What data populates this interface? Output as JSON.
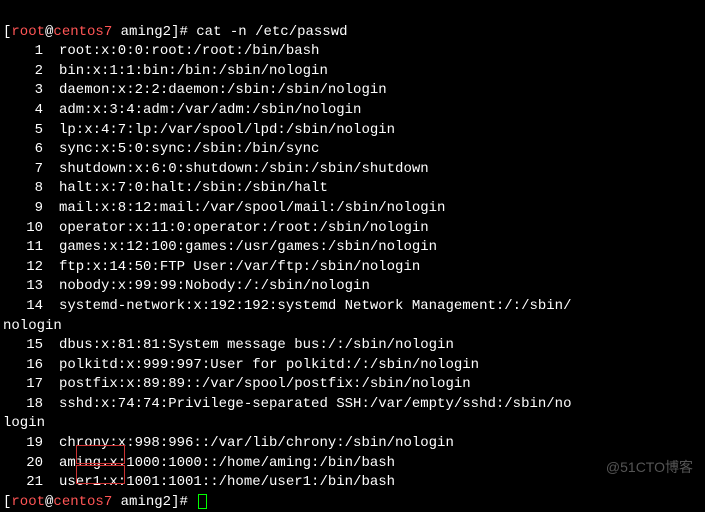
{
  "prompt": {
    "user": "root",
    "host": "centos7",
    "path": "aming2",
    "symbol": "#"
  },
  "command": "cat -n /etc/passwd",
  "lines": [
    {
      "n": "1",
      "text": "root:x:0:0:root:/root:/bin/bash"
    },
    {
      "n": "2",
      "text": "bin:x:1:1:bin:/bin:/sbin/nologin"
    },
    {
      "n": "3",
      "text": "daemon:x:2:2:daemon:/sbin:/sbin/nologin"
    },
    {
      "n": "4",
      "text": "adm:x:3:4:adm:/var/adm:/sbin/nologin"
    },
    {
      "n": "5",
      "text": "lp:x:4:7:lp:/var/spool/lpd:/sbin/nologin"
    },
    {
      "n": "6",
      "text": "sync:x:5:0:sync:/sbin:/bin/sync"
    },
    {
      "n": "7",
      "text": "shutdown:x:6:0:shutdown:/sbin:/sbin/shutdown"
    },
    {
      "n": "8",
      "text": "halt:x:7:0:halt:/sbin:/sbin/halt"
    },
    {
      "n": "9",
      "text": "mail:x:8:12:mail:/var/spool/mail:/sbin/nologin"
    },
    {
      "n": "10",
      "text": "operator:x:11:0:operator:/root:/sbin/nologin"
    },
    {
      "n": "11",
      "text": "games:x:12:100:games:/usr/games:/sbin/nologin"
    },
    {
      "n": "12",
      "text": "ftp:x:14:50:FTP User:/var/ftp:/sbin/nologin"
    },
    {
      "n": "13",
      "text": "nobody:x:99:99:Nobody:/:/sbin/nologin"
    },
    {
      "n": "14",
      "text": "systemd-network:x:192:192:systemd Network Management:/:/sbin/",
      "wrap": "nologin"
    },
    {
      "n": "15",
      "text": "dbus:x:81:81:System message bus:/:/sbin/nologin"
    },
    {
      "n": "16",
      "text": "polkitd:x:999:997:User for polkitd:/:/sbin/nologin"
    },
    {
      "n": "17",
      "text": "postfix:x:89:89::/var/spool/postfix:/sbin/nologin"
    },
    {
      "n": "18",
      "text": "sshd:x:74:74:Privilege-separated SSH:/var/empty/sshd:/sbin/no",
      "wrap": "login"
    },
    {
      "n": "19",
      "text": "chrony:x:998:996::/var/lib/chrony:/sbin/nologin"
    },
    {
      "n": "20",
      "text": "aming:x:1000:1000::/home/aming:/bin/bash"
    },
    {
      "n": "21",
      "text": "user1:x:1001:1001::/home/user1:/bin/bash"
    }
  ],
  "watermark": "@51CTO博客"
}
